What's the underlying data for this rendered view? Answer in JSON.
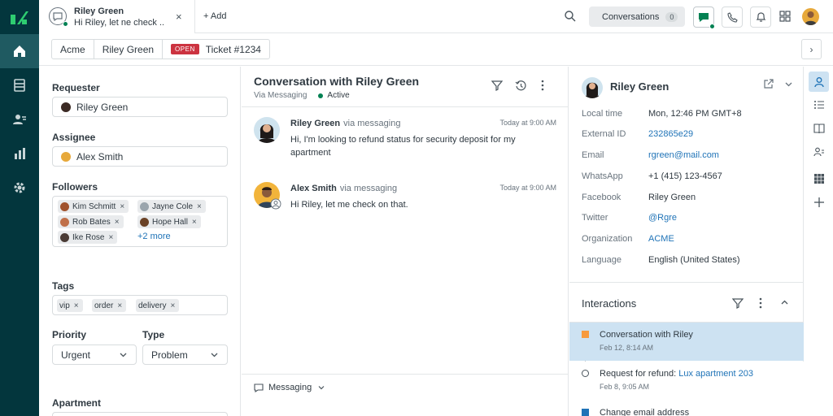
{
  "tab": {
    "title": "Riley Green",
    "subtitle": "Hi Riley, let ne check ...",
    "close": "×",
    "add_label": "+ Add"
  },
  "topbar": {
    "conversations_label": "Conversations",
    "conversations_count": "0"
  },
  "breadcrumb": {
    "org": "Acme",
    "requester": "Riley Green",
    "status": "OPEN",
    "ticket": "Ticket #1234",
    "next": "›"
  },
  "properties": {
    "requester_label": "Requester",
    "requester_value": "Riley Green",
    "assignee_label": "Assignee",
    "assignee_value": "Alex Smith",
    "followers_label": "Followers",
    "followers": [
      {
        "name": "Kim Schmitt"
      },
      {
        "name": "Jayne Cole"
      },
      {
        "name": "Rob Bates"
      },
      {
        "name": "Hope Hall"
      },
      {
        "name": "Ike Rose"
      }
    ],
    "followers_more": "+2 more",
    "tags_label": "Tags",
    "tags": [
      "vip",
      "order",
      "delivery"
    ],
    "priority_label": "Priority",
    "priority_value": "Urgent",
    "type_label": "Type",
    "type_value": "Problem",
    "apartment_label": "Apartment"
  },
  "conversation": {
    "title": "Conversation with Riley Green",
    "channel": "Via Messaging",
    "status": "Active",
    "messages": [
      {
        "author": "Riley Green",
        "via": "via messaging",
        "time": "Today at 9:00 AM",
        "text": "Hi, I'm looking to refund status for security deposit for my apartment"
      },
      {
        "author": "Alex Smith",
        "via": "via messaging",
        "time": "Today at 9:00 AM",
        "text": "Hi Riley, let me check on that."
      }
    ],
    "composer_channel": "Messaging"
  },
  "customer": {
    "name": "Riley Green",
    "fields": [
      {
        "label": "Local time",
        "value": "Mon, 12:46 PM GMT+8"
      },
      {
        "label": "External ID",
        "value": "232865e29"
      },
      {
        "label": "Email",
        "value": "rgreen@mail.com"
      },
      {
        "label": "WhatsApp",
        "value": "+1 (415) 123-4567"
      },
      {
        "label": "Facebook",
        "value": "Riley Green"
      },
      {
        "label": "Twitter",
        "value": "@Rgre"
      },
      {
        "label": "Organization",
        "value": "ACME"
      },
      {
        "label": "Language",
        "value": "English (United States)"
      }
    ],
    "interactions_label": "Interactions",
    "interactions": [
      {
        "title": "Conversation with Riley",
        "date": "Feb 12, 8:14 AM"
      },
      {
        "title": "Request for refund: ",
        "link": "Lux apartment 203",
        "date": "Feb 8, 9:05 AM"
      },
      {
        "title": "Change email address",
        "date": ""
      }
    ]
  },
  "colors": {
    "nav_bg": "#03363d",
    "open_badge": "#cc3340",
    "link": "#1f73b7",
    "active_green": "#038153",
    "selected_row": "#cde2f2",
    "marker_orange": "#f79a3e",
    "marker_blue": "#1f73b7"
  },
  "icons": {
    "nav": [
      "home-icon",
      "views-icon",
      "customers-icon",
      "reporting-icon",
      "settings-icon"
    ],
    "rail": [
      "user-icon",
      "list-icon",
      "knowledge-icon",
      "customer-context-icon",
      "apps-icon",
      "add-icon"
    ]
  }
}
